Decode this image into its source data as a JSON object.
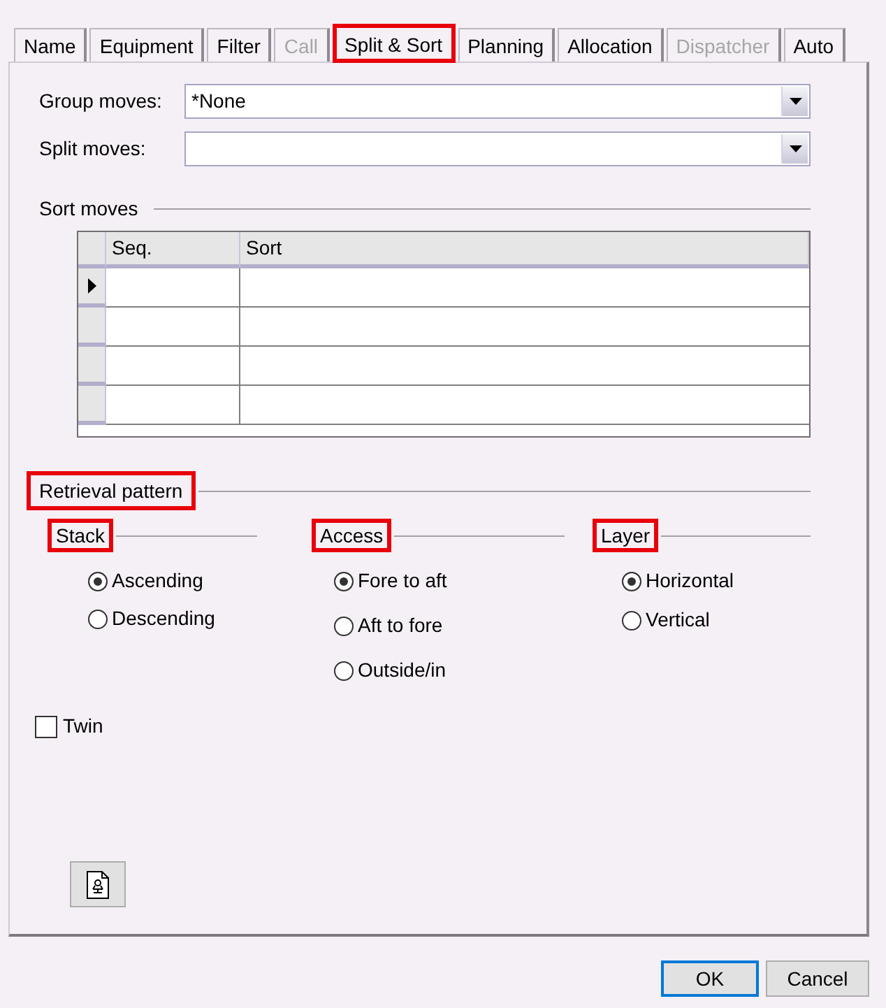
{
  "tabs": [
    {
      "label": "Name",
      "selected": false,
      "disabled": false,
      "highlighted": false
    },
    {
      "label": "Equipment",
      "selected": false,
      "disabled": false,
      "highlighted": false
    },
    {
      "label": "Filter",
      "selected": false,
      "disabled": false,
      "highlighted": false
    },
    {
      "label": "Call",
      "selected": false,
      "disabled": true,
      "highlighted": false
    },
    {
      "label": "Split & Sort",
      "selected": true,
      "disabled": false,
      "highlighted": true
    },
    {
      "label": "Planning",
      "selected": false,
      "disabled": false,
      "highlighted": false
    },
    {
      "label": "Allocation",
      "selected": false,
      "disabled": false,
      "highlighted": false
    },
    {
      "label": "Dispatcher",
      "selected": false,
      "disabled": true,
      "highlighted": false
    },
    {
      "label": "Auto",
      "selected": false,
      "disabled": false,
      "highlighted": false
    }
  ],
  "fields": [
    {
      "label": "Group moves:",
      "value": "*None"
    },
    {
      "label": "Split moves:"
    }
  ],
  "sort_moves": {
    "title": "Sort moves",
    "highlighted": false,
    "columns": [
      "Seq.",
      "Sort"
    ],
    "rows": [
      {
        "current": true
      },
      {
        "current": false
      },
      {
        "current": false
      },
      {
        "current": false
      }
    ]
  },
  "retrieval_pattern": {
    "title": "Retrieval pattern",
    "highlighted": true,
    "groups": [
      {
        "title": "Stack",
        "highlighted": true,
        "options": [
          {
            "label": "Ascending",
            "selected": true
          },
          {
            "label": "Descending",
            "selected": false
          }
        ]
      },
      {
        "title": "Access",
        "highlighted": true,
        "options": [
          {
            "label": "Fore to aft",
            "selected": true
          },
          {
            "label": "Aft to fore",
            "selected": false
          },
          {
            "label": "Outside/in",
            "selected": false
          }
        ]
      },
      {
        "title": "Layer",
        "highlighted": true,
        "options": [
          {
            "label": "Horizontal",
            "selected": true
          },
          {
            "label": "Vertical",
            "selected": false
          }
        ]
      }
    ]
  },
  "twin": {
    "label": "Twin",
    "checked": false
  },
  "buttons": [
    {
      "label": "OK",
      "focused": true
    },
    {
      "label": "Cancel",
      "focused": false
    }
  ]
}
